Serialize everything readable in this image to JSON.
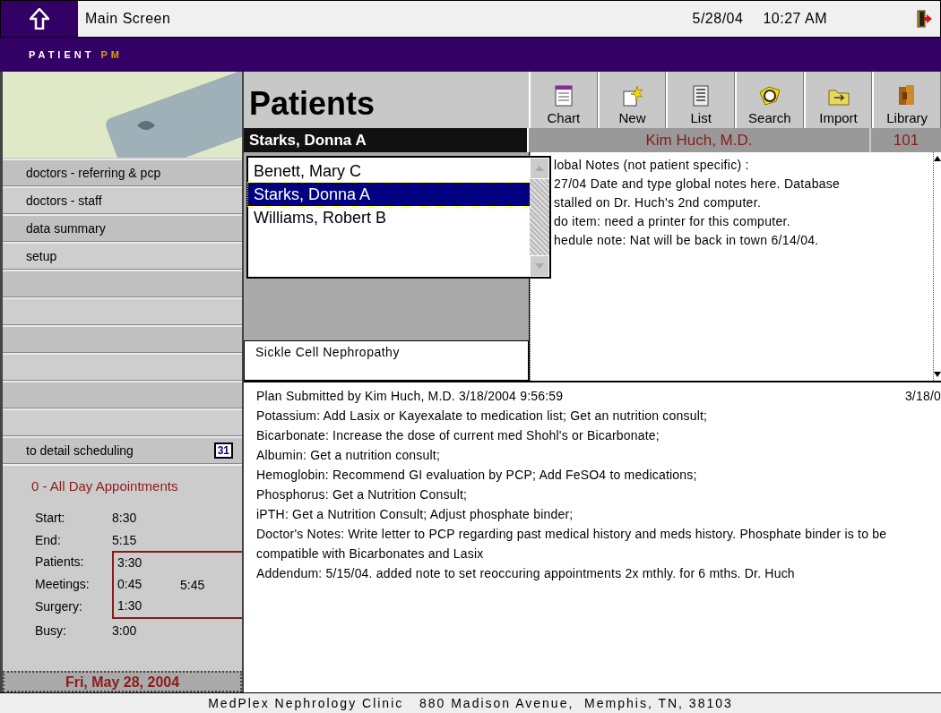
{
  "top_bar": {
    "title": "Main Screen",
    "date": "5/28/04",
    "time": "10:27 AM"
  },
  "brand": {
    "word": "PATIENT",
    "accent": "PM"
  },
  "sidebar": {
    "items": [
      {
        "label": "doctors - referring & pcp"
      },
      {
        "label": "doctors - staff"
      },
      {
        "label": "data summary"
      },
      {
        "label": "setup"
      }
    ],
    "scheduling_link": {
      "label": "to detail scheduling",
      "calendar_day": "31"
    }
  },
  "schedule": {
    "summary": "0 - All Day Appointments",
    "rows_before": [
      {
        "label": "Start:",
        "value": "8:30"
      },
      {
        "label": "End:",
        "value": "5:15"
      }
    ],
    "group": {
      "rows": [
        {
          "label": "Patients:",
          "value": "3:30"
        },
        {
          "label": "Meetings:",
          "value": "0:45"
        },
        {
          "label": "Surgery:",
          "value": "1:30"
        }
      ],
      "total": "5:45"
    },
    "rows_after": [
      {
        "label": "Busy:",
        "value": "3:00"
      }
    ],
    "date": "Fri, May 28, 2004"
  },
  "header": {
    "title": "Patients"
  },
  "toolbar": [
    {
      "label": "Chart",
      "kind": "chart"
    },
    {
      "label": "New",
      "kind": "new"
    },
    {
      "label": "List",
      "kind": "list"
    },
    {
      "label": "Search",
      "kind": "search"
    },
    {
      "label": "Import",
      "kind": "import"
    },
    {
      "label": "Library",
      "kind": "library"
    }
  ],
  "current_patient": "Starks, Donna A",
  "doctor": "Kim Huch, M.D.",
  "room": "101",
  "patient_list": [
    {
      "name": "Benett, Mary C",
      "selected": false
    },
    {
      "name": "Starks, Donna A",
      "selected": true
    },
    {
      "name": "Williams, Robert B",
      "selected": false
    }
  ],
  "diagnosis": "Sickle Cell Nephropathy",
  "global_notes": [
    "lobal Notes (not patient specific) :",
    "27/04 Date and type global notes here. Database",
    "stalled on Dr. Huch's 2nd computer.",
    "do item: need a printer for this computer.",
    "hedule note: Nat will be back in town 6/14/04."
  ],
  "plan": {
    "title": "Plan Submitted by Kim Huch, M.D. 3/18/2004 9:56:59",
    "date": "3/18/0",
    "lines": [
      "Potassium: Add Lasix or Kayexalate to medication list; Get an nutrition consult;",
      "Bicarbonate: Increase the dose of current med Shohl's or Bicarbonate;",
      "Albumin: Get a nutrition consult;",
      "Hemoglobin: Recommend GI evaluation by PCP; Add FeSO4 to medications;",
      "Phosphorus: Get a Nutrition Consult;",
      "iPTH: Get a Nutrition Consult; Adjust phosphate binder;",
      "Doctor's Notes: Write letter to PCP regarding past medical history and meds history. Phosphate binder is to be compatible with Bicarbonates and Lasix",
      "Addendum: 5/15/04. added note to set reoccuring appointments 2x mthly. for 6 mths. Dr. Huch"
    ]
  },
  "footer": "MedPlex Nephrology Clinic   880 Madison Avenue,  Memphis, TN, 38103"
}
